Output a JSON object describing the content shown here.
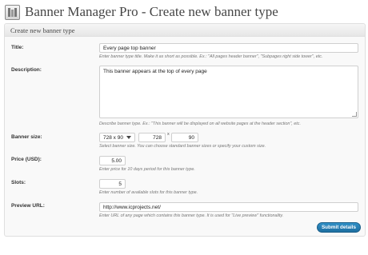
{
  "page": {
    "title": "Banner Manager Pro - Create new banner type"
  },
  "panel": {
    "title": "Create new banner type"
  },
  "form": {
    "title": {
      "label": "Title:",
      "value": "Every page top banner",
      "hint": "Enter banner type title. Make it as short as possible. Ex.: \"All pages header banner\", \"Subpages right side tower\", etc."
    },
    "description": {
      "label": "Description:",
      "value": "This banner appears at the top of every page",
      "hint": "Describe banner type. Ex.: \"This banner will be displayed on all website pages at the header section\", etc."
    },
    "banner_size": {
      "label": "Banner size:",
      "selected": "728 x 90",
      "width": "728",
      "separator": "x",
      "height": "90",
      "hint": "Select banner size. You can choose standard banner sizes or specify your custom size."
    },
    "price": {
      "label": "Price (USD):",
      "value": "5.00",
      "hint": "Enter price for 10 days period for this banner type."
    },
    "slots": {
      "label": "Slots:",
      "value": "5",
      "hint": "Enter number of available slots for this banner type."
    },
    "preview_url": {
      "label": "Preview URL:",
      "value": "http://www.icprojects.net/",
      "hint": "Enter URL of any page which contains this banner type. It is used for \"Live preview\" functionality."
    }
  },
  "submit": {
    "label": "Submit details"
  },
  "icons": {
    "page_icon": "settings-icon",
    "select_arrow": "chevron-down-icon",
    "resize": "resize-grip-icon"
  }
}
